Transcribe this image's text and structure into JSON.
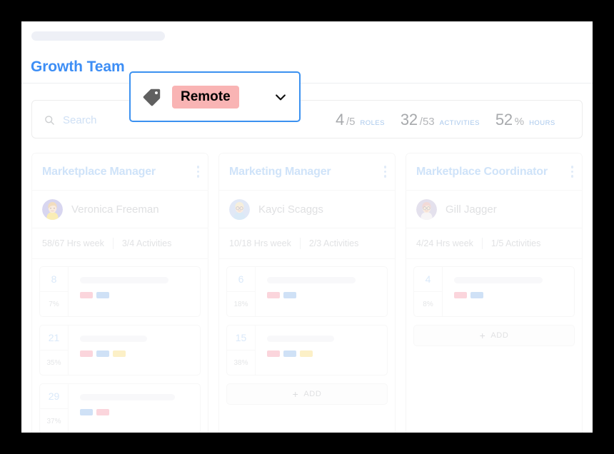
{
  "header": {
    "breadcrumb_placeholder": "",
    "title": "Growth Team"
  },
  "toolbar": {
    "search": {
      "placeholder": "Search",
      "value": "",
      "icon": "search-icon"
    },
    "stats": [
      {
        "value": "4",
        "sub": "/5",
        "label": "ROLES"
      },
      {
        "value": "32",
        "sub": "/53",
        "label": "ACTIVITIES"
      },
      {
        "value": "52",
        "sub": "%",
        "label": "HOURS"
      }
    ]
  },
  "tag_dropdown": {
    "icon": "tag-icon",
    "chip_label": "Remote",
    "chip_color": "#f9b4b4",
    "border_color": "#3b91f0",
    "chevron": "chevron-down-icon"
  },
  "colors": {
    "accent_blue": "#3d8ef5",
    "tag_pink": "#f9b4c0",
    "tag_blue": "#a8c9f0",
    "tag_yellow": "#fbe49a"
  },
  "columns": [
    {
      "title": "Marketplace Manager",
      "person": "Veronica Freeman",
      "hours": "58/67 Hrs week",
      "activities": "3/4 Activities",
      "items": [
        {
          "num": "8",
          "pct": "7%",
          "bar": 74,
          "tags": [
            "pink",
            "blue"
          ]
        },
        {
          "num": "21",
          "pct": "35%",
          "bar": 56,
          "tags": [
            "pink",
            "blue",
            "yellow"
          ]
        },
        {
          "num": "29",
          "pct": "37%",
          "bar": 79,
          "tags": [
            "blue",
            "pink"
          ]
        }
      ],
      "add_label": "ADD",
      "show_add": false
    },
    {
      "title": "Marketing Manager",
      "person": "Kayci Scaggs",
      "hours": "10/18 Hrs week",
      "activities": "2/3 Activities",
      "items": [
        {
          "num": "6",
          "pct": "18%",
          "bar": 74,
          "tags": [
            "pink",
            "blue"
          ]
        },
        {
          "num": "15",
          "pct": "38%",
          "bar": 56,
          "tags": [
            "pink",
            "blue",
            "yellow"
          ]
        }
      ],
      "add_label": "ADD",
      "show_add": true
    },
    {
      "title": "Marketplace Coordinator",
      "person": "Gill Jagger",
      "hours": "4/24 Hrs week",
      "activities": "1/5 Activities",
      "items": [
        {
          "num": "4",
          "pct": "8%",
          "bar": 74,
          "tags": [
            "pink",
            "blue"
          ]
        }
      ],
      "add_label": "ADD",
      "show_add": true
    }
  ]
}
